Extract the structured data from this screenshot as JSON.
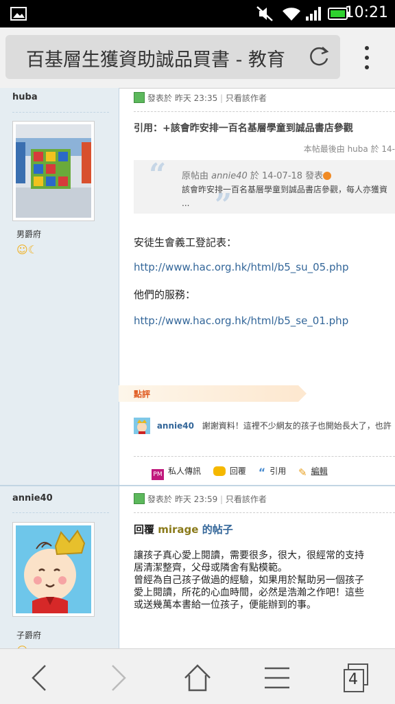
{
  "status_bar": {
    "time": "10:21"
  },
  "browser": {
    "page_title": "百基層生獲資助誠品買書 - 教育",
    "tab_count": "4"
  },
  "posts": [
    {
      "author": "huba",
      "rank": "男爵府",
      "meta_posted": "發表於 昨天 23:35",
      "meta_author_only": "只看該作者",
      "quote_title": "引用：+該會昨安排一百名基層學童到誠品書店參觀",
      "last_edited": "本帖最後由 huba 於 14-",
      "quote_header": "原帖由",
      "quote_author": "annie40",
      "quote_header_tail": "於 14-07-18 發表",
      "quote_body": "該會昨安排一百名基層學童到誠品書店參觀，每人亦獲資",
      "quote_ellipsis": "...",
      "body": [
        "安徒生會義工登記表：",
        "http://www.hac.org.hk/html/b5_su_05.php",
        "他們的服務：",
        "http://www.hac.org.hk/html/b5_se_01.php"
      ],
      "rating_label": "點評",
      "rater_name": "annie40",
      "rater_comment": "謝謝資料！這裡不少網友的孩子也開始長大了，也許",
      "actions": {
        "pm": "私人傳訊",
        "reply": "回覆",
        "quote": "引用",
        "edit": "編輯"
      }
    },
    {
      "author": "annie40",
      "rank": "子爵府",
      "meta_posted": "發表於 昨天 23:59",
      "meta_author_only": "只看該作者",
      "reply_prefix": "回覆",
      "reply_name": "mirage",
      "reply_suffix": "的帖子",
      "body": [
        "讓孩子真心愛上閱讀，需要很多，很大，很經常的支持",
        "居清潔整齊，父母或隣舍有點模範。",
        "曾經為自己孩子做過的經驗，如果用於幫助另一個孩子",
        "愛上閱讀，所花的心血時間，必然是浩瀚之作吧！這些",
        "或送幾萬本書給一位孩子，便能辦到的事。"
      ]
    }
  ],
  "colors": {
    "sidebar_bg": "#e5edf2",
    "link": "#336699",
    "rate_label": "#e05a20"
  },
  "icons": [
    "picture-icon",
    "mute-icon",
    "wifi-icon",
    "signal-icon",
    "battery-icon",
    "reload-icon",
    "overflow-menu-icon",
    "back-icon",
    "forward-icon",
    "home-icon",
    "menu-icon",
    "tabs-icon"
  ]
}
